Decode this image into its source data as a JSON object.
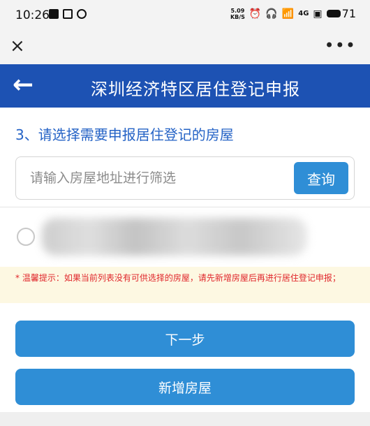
{
  "statusbar": {
    "time": "10:26",
    "net_speed_value": "5.09",
    "net_speed_unit": "KB/S",
    "signal_label": "4G",
    "battery": "71"
  },
  "browser": {
    "close_glyph": "×",
    "more_glyph": "•••"
  },
  "nav": {
    "back_glyph": "←",
    "title": "深圳经济特区居住登记申报"
  },
  "main": {
    "step_title": "3、请选择需要申报居住登记的房屋",
    "search": {
      "placeholder": "请输入房屋地址进行筛选",
      "value": "",
      "button_label": "查询"
    },
    "tip": "* 温馨提示：如果当前列表没有可供选择的房屋，请先新增房屋后再进行居住登记申报；",
    "next_label": "下一步",
    "add_house_label": "新增房屋"
  },
  "colors": {
    "nav_bg": "#1d52b3",
    "accent": "#2f8ed6",
    "step_title": "#2563c6",
    "tip_text": "#e0262b",
    "tip_bg": "#fdf8e2"
  },
  "icons": {
    "close": "close-icon",
    "more": "more-options-icon",
    "back": "back-arrow-icon",
    "radio": "radio-unselected-icon"
  }
}
